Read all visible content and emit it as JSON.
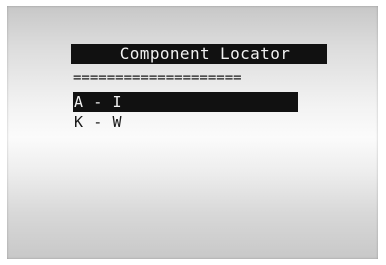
{
  "screen": {
    "title": "Component Locator",
    "separator": "===================="
  },
  "menu": {
    "items": [
      {
        "label": "A - I",
        "selected": true
      },
      {
        "label": "K - W",
        "selected": false
      }
    ]
  },
  "colors": {
    "highlight": "#111111",
    "highlight_text": "#f2f2f2",
    "text": "#1a1a1a"
  }
}
